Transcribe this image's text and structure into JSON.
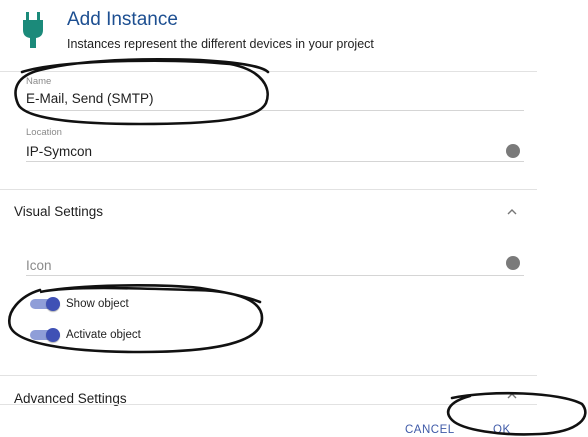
{
  "dialog": {
    "title": "Add Instance",
    "subtitle": "Instances represent the different devices in your project",
    "icon": "plug-icon"
  },
  "fields": {
    "name": {
      "label": "Name",
      "value": "E-Mail, Send (SMTP)"
    },
    "location": {
      "label": "Location",
      "value": "IP-Symcon",
      "icon": "select-icon"
    }
  },
  "visual_settings": {
    "title": "Visual Settings",
    "expanded": true,
    "icon_field": {
      "placeholder": "Icon",
      "icon": "select-icon"
    },
    "toggles": [
      {
        "label": "Show object",
        "checked": true
      },
      {
        "label": "Activate object",
        "checked": true
      }
    ]
  },
  "advanced_settings": {
    "title": "Advanced Settings"
  },
  "actions": {
    "cancel": "CANCEL",
    "ok": "OK"
  },
  "colors": {
    "accent": "#3f51b5",
    "title": "#1d4f91",
    "plug_icon": "#1b8a7a",
    "annotation": "#111111"
  }
}
